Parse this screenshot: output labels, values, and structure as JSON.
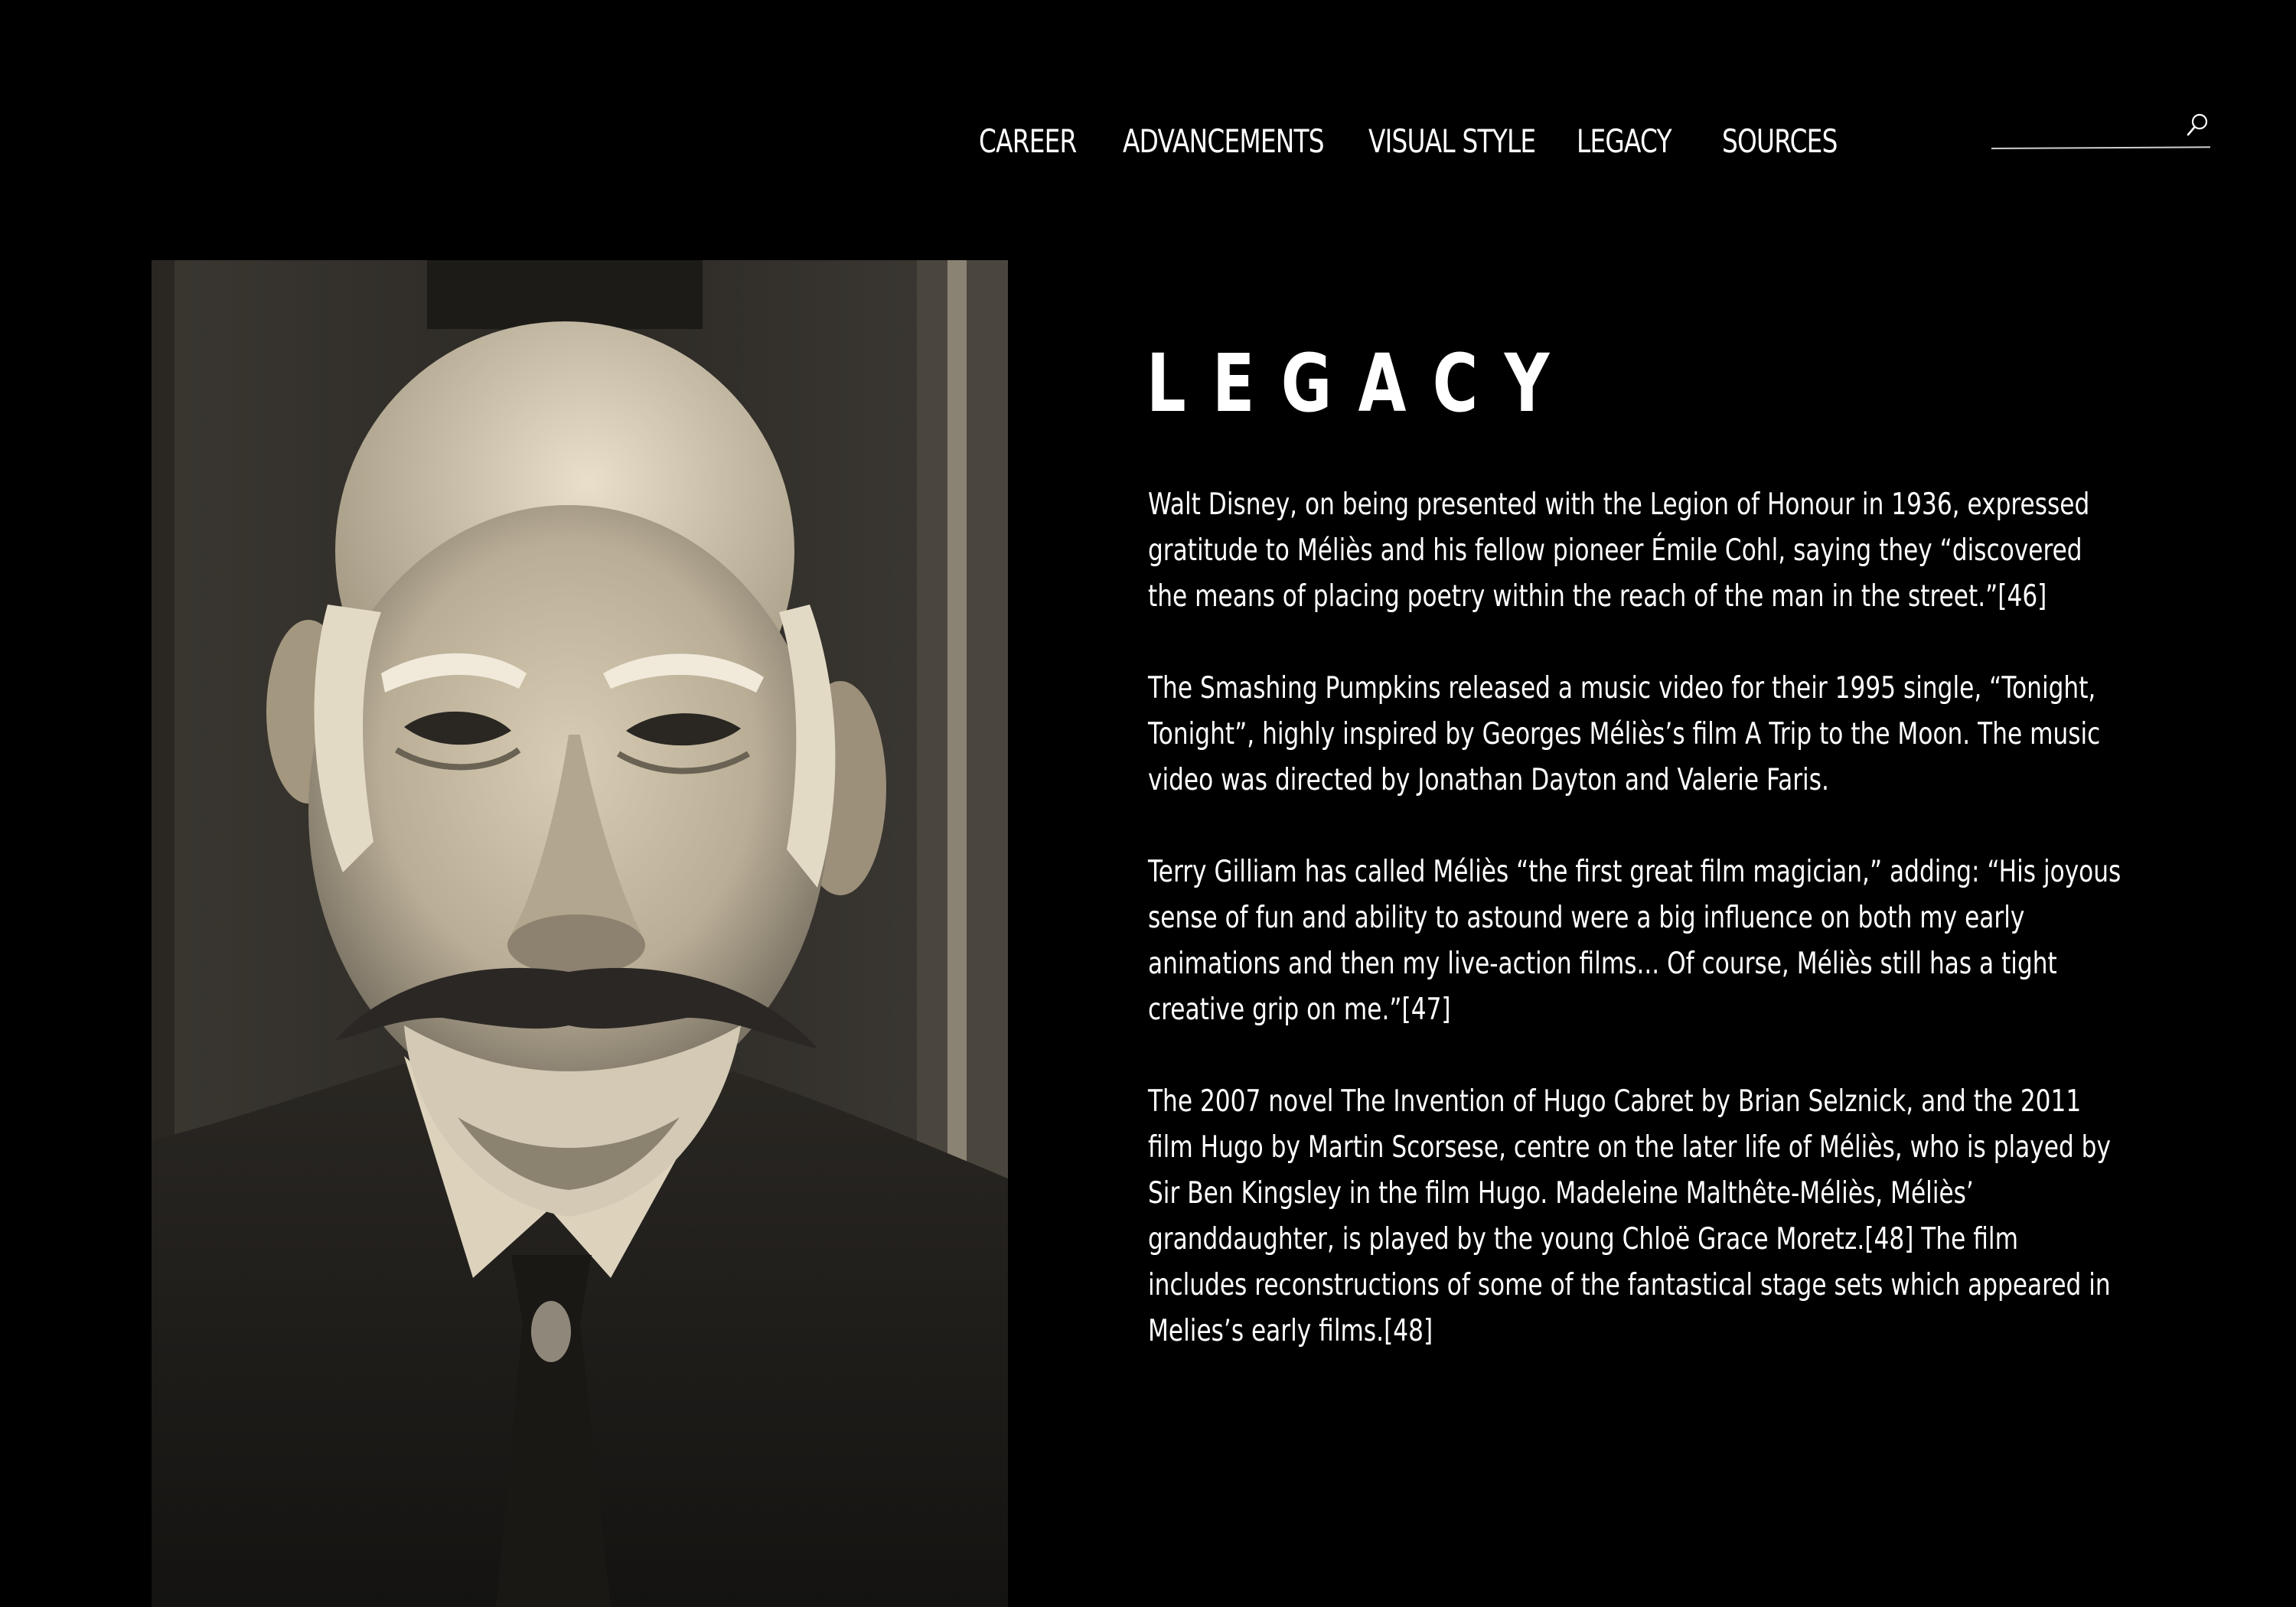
{
  "nav": {
    "items": [
      {
        "label": "CAREER"
      },
      {
        "label": "ADVANCEMENTS"
      },
      {
        "label": "VISUAL STYLE"
      },
      {
        "label": "LEGACY"
      },
      {
        "label": "SOURCES"
      }
    ]
  },
  "search": {
    "placeholder": "",
    "value": "",
    "icon": "search-icon"
  },
  "portrait": {
    "description_icon": "portrait-photo"
  },
  "section": {
    "title": "LEGACY",
    "paragraphs": [
      "Walt Disney, on being presented with the Legion of Honour in 1936, expressed gratitude to Méliès and his fellow pioneer Émile Cohl, saying they “discovered the means of placing poetry within the reach of the man in the street.”[46]",
      "The Smashing Pumpkins released a music video for their 1995 single, “Tonight, Tonight”, highly inspired by Georges Méliès’s film A Trip to the Moon. The music video was directed by Jonathan Dayton and Valerie Faris.",
      "Terry Gilliam has called Méliès “the first great film magician,” adding: “His joyous sense of fun and ability to astound were a big influence on both my early animations and then my live-action films... Of course, Méliès still has a tight creative grip on me.”[47]",
      "The 2007 novel The Invention of Hugo Cabret by Brian Selznick, and the 2011 film Hugo by Martin Scorsese, centre on the later life of Méliès, who is played by Sir Ben Kingsley in the film Hugo. Madeleine Malthête-Méliès, Méliès’ granddaughter, is played by the young Chloë Grace Moretz.[48] The film includes reconstructions of some of the fantastical stage sets which appeared in Melies’s early films.[48]"
    ]
  },
  "colors": {
    "background": "#000000",
    "text": "#ffffff"
  }
}
